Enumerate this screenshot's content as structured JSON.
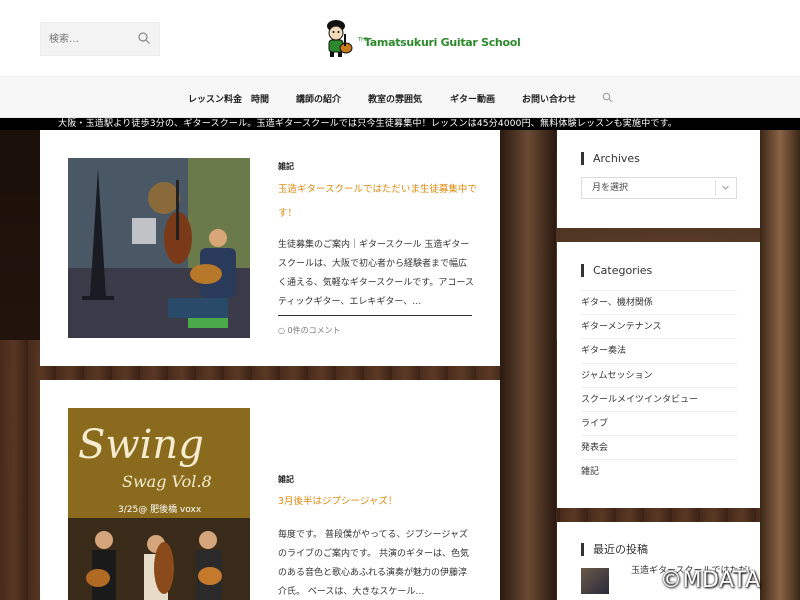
{
  "header": {
    "search_placeholder": "検索…",
    "logo_the": "THE",
    "logo_text": "Tamatsukuri Guitar School"
  },
  "nav": {
    "items": [
      "レッスン料金　時間",
      "講師の紹介",
      "教室の雰囲気",
      "ギター動画",
      "お問い合わせ"
    ]
  },
  "ticker": "大阪・玉造駅より徒歩3分の、ギタースクール。玉造ギタースクールでは只今生徒募集中！レッスンは45分4000円、無料体験レッスンも実施中です。",
  "posts": [
    {
      "category": "雑記",
      "title": "玉造ギタースクールではただいま生徒募集中です！",
      "excerpt": "生徒募集のご案内｜ギタースクール 玉造ギタースクールは、大阪で初心者から経験者まで幅広く通える、気軽なギタースクールです。アコースティックギター、エレキギター、…",
      "comments": "0件のコメント"
    },
    {
      "category": "雑記",
      "title": "3月後半はジプシージャズ！",
      "excerpt": "毎度です。 普段僕がやってる、ジプシージャズのライブのご案内です。 共演のギターは、色気のある音色と歌心あふれる演奏が魅力の伊藤淳介氏。 ベースは、大きなスケール…",
      "thumb_title": "Swing",
      "thumb_subtitle": "Swag Vol.8",
      "thumb_date": "3/25@ 肥後橋 voxx"
    }
  ],
  "sidebar": {
    "archives": {
      "title": "Archives",
      "select_value": "月を選択"
    },
    "categories": {
      "title": "Categories",
      "items": [
        "ギター、機材関係",
        "ギターメンテナンス",
        "ギター奏法",
        "ジャムセッション",
        "スクールメイツインタビュー",
        "ライブ",
        "発表会",
        "雑記"
      ]
    },
    "recent": {
      "title": "最近の投稿",
      "first_title": "玉造ギタースクールではただいま生徒募集中です！"
    }
  },
  "watermark": "©MDATA",
  "colors": {
    "accent": "#e08a12",
    "ticker_bg": "#000000",
    "logo_green": "#2c8a2c"
  }
}
